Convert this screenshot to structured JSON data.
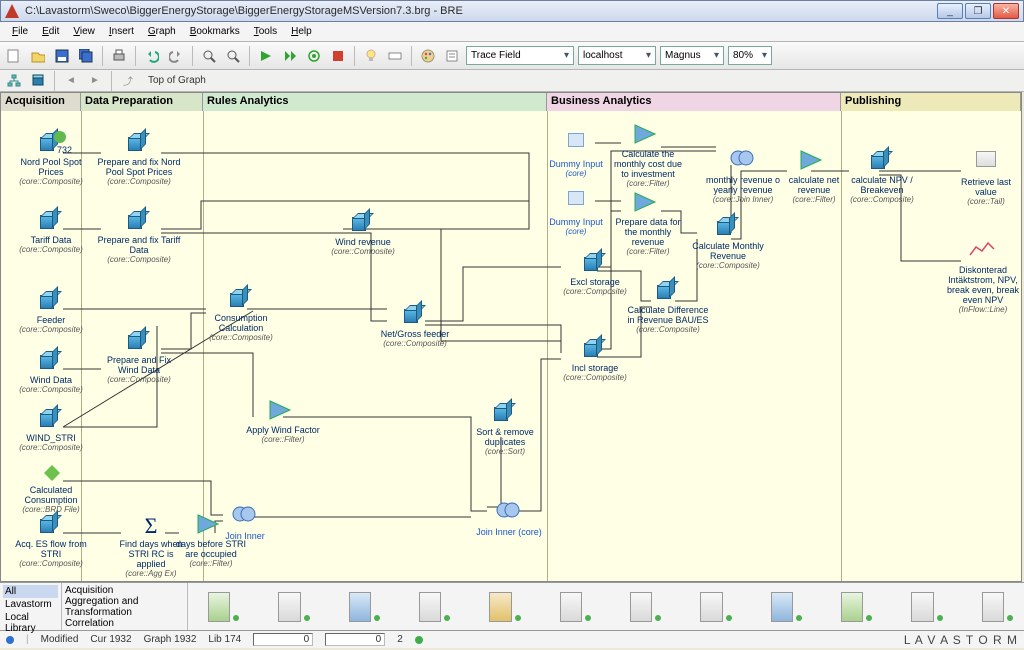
{
  "window": {
    "title": "C:\\Lavastorm\\Sweco\\BiggerEnergyStorage\\BiggerEnergyStorageMSVersion7.3.brg - BRE",
    "min": "_",
    "max": "❐",
    "close": "✕"
  },
  "menu": {
    "file": "File",
    "edit": "Edit",
    "view": "View",
    "insert": "Insert",
    "graph": "Graph",
    "bookmarks": "Bookmarks",
    "tools": "Tools",
    "help": "Help"
  },
  "toolbar": {
    "trace_field": "Trace Field",
    "host": "localhost",
    "user": "Magnus",
    "zoom": "80%"
  },
  "breadcrumb": "Top of Graph",
  "lanes": {
    "acquisition": "Acquisition",
    "dataprep": "Data Preparation",
    "rules": "Rules Analytics",
    "business": "Business Analytics",
    "publishing": "Publishing"
  },
  "nodes": {
    "nordpool": {
      "label": "Nord Pool Spot Prices",
      "sub": "(core::Composite)",
      "count": "732"
    },
    "prep_nord": {
      "label": "Prepare and fix Nord Pool Spot Prices",
      "sub": "(core::Composite)"
    },
    "tariff": {
      "label": "Tariff Data",
      "sub": "(core::Composite)"
    },
    "prep_tariff": {
      "label": "Prepare and fix Tariff Data",
      "sub": "(core::Composite)"
    },
    "feeder": {
      "label": "Feeder",
      "sub": "(core::Composite)"
    },
    "winddata": {
      "label": "Wind Data",
      "sub": "(core::Composite)"
    },
    "windstri": {
      "label": "WIND_STRI",
      "sub": "(core::Composite)"
    },
    "calccons": {
      "label": "Calculated Consumption",
      "sub": "(core::BRD File)"
    },
    "acqes": {
      "label": "Acq. ES flow from STRI",
      "sub": "(core::Composite)"
    },
    "prep_wind": {
      "label": "Prepare and Fix Wind Data",
      "sub": "(core::Composite)"
    },
    "cons_calc": {
      "label": "Consumption Calculation",
      "sub": "(core::Composite)"
    },
    "wind_rev": {
      "label": "Wind revenue",
      "sub": "(core::Composite)"
    },
    "apply_wf": {
      "label": "Apply Wind Factor",
      "sub": "(core::Filter)"
    },
    "netfeeder": {
      "label": "Net/Gross feeder",
      "sub": "(core::Composite)"
    },
    "finddays": {
      "label": "Find days when STRI RC is applied",
      "sub": "(core::Agg Ex)"
    },
    "daysbefore": {
      "label": "days before STRI are occupied",
      "sub": "(core::Filter)"
    },
    "joininner1": {
      "label": "Join Inner",
      "sub": ""
    },
    "joininner2": {
      "label": "Join Inner  (core)",
      "sub": ""
    },
    "sortdup": {
      "label": "Sort & remove duplicates",
      "sub": "(core::Sort)"
    },
    "dummy1": {
      "label": "Dummy  Input",
      "sub": "(core)"
    },
    "dummy2": {
      "label": "Dummy  Input",
      "sub": "(core)"
    },
    "calc_mcost": {
      "label": "Calculate the monthly cost due to investment",
      "sub": "(core::Filter)"
    },
    "prep_mrev": {
      "label": "Prepare data for the monthly revenue",
      "sub": "(core::Filter)"
    },
    "excl": {
      "label": "Excl storage",
      "sub": "(core::Composite)"
    },
    "incl": {
      "label": "Incl storage",
      "sub": "(core::Composite)"
    },
    "calc_diff": {
      "label": "Calculate Difference in Revenue BAU/ES",
      "sub": "(core::Composite)"
    },
    "mon_rev": {
      "label": "Calculate Monthly Revenue",
      "sub": "(core::Composite)"
    },
    "my_rev": {
      "label": "monthly revenue o yearly revenue",
      "sub": "(core::Join Inner)"
    },
    "net_rev": {
      "label": "calculate net revenue",
      "sub": "(core::Filter)"
    },
    "npv": {
      "label": "calculate NPV / Breakeven",
      "sub": "(core::Composite)"
    },
    "retrieve": {
      "label": "Retrieve last value",
      "sub": "(core::Tail)"
    },
    "diskont": {
      "label": "Diskonterad Intäktstrom, NPV, break even, break even NPV",
      "sub": "(InFlow::Line)"
    }
  },
  "library": {
    "col1_all": "All",
    "col1_lav": "Lavastorm",
    "col1_local": "Local Library",
    "col2_acq": "Acquisition",
    "col2_agg": "Aggregation and Transformation",
    "col2_corr": "Correlation"
  },
  "status": {
    "modified": "Modified",
    "cur": "Cur 1932",
    "graph": "Graph 1932",
    "lib": "Lib 174",
    "f1": "0",
    "f2": "0",
    "f3": "2",
    "brand": "L A V A S T O R M"
  }
}
